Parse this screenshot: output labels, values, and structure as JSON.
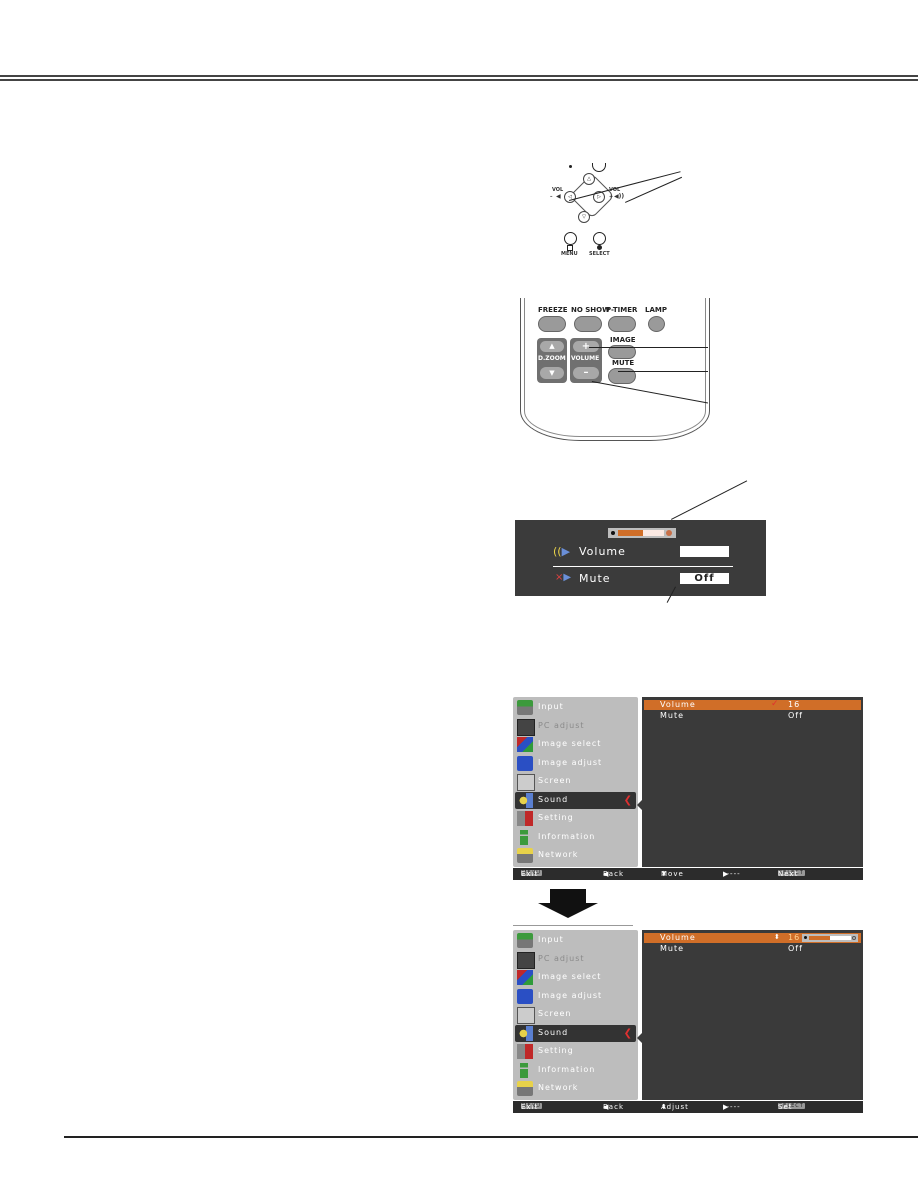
{
  "control_panel": {
    "vol_minus_label": "VOL",
    "vol_minus_sign": "–",
    "vol_plus_label": "VOL",
    "vol_plus_sign": "+",
    "menu_label": "MENU",
    "select_label": "SELECT"
  },
  "remote": {
    "freeze": "FREEZE",
    "no_show": "NO SHOW",
    "p_timer": "P-TIMER",
    "lamp": "LAMP",
    "image": "IMAGE",
    "mute": "MUTE",
    "d_zoom": "D.ZOOM",
    "volume": "VOLUME",
    "plus": "+",
    "minus": "–",
    "up": "▲",
    "down": "▼"
  },
  "volume_osd": {
    "volume_label": "Volume",
    "volume_value": "",
    "volume_level_fraction": 0.55,
    "mute_label": "Mute",
    "mute_value": "Off"
  },
  "menu_screen_1": {
    "items": [
      {
        "label": "Input",
        "icon": "input-icon",
        "dim": false
      },
      {
        "label": "PC adjust",
        "icon": "pc-adjust-icon",
        "dim": true
      },
      {
        "label": "Image select",
        "icon": "image-select-icon",
        "dim": false
      },
      {
        "label": "Image adjust",
        "icon": "image-adjust-icon",
        "dim": false
      },
      {
        "label": "Screen",
        "icon": "screen-icon",
        "dim": false
      },
      {
        "label": "Sound",
        "icon": "sound-icon",
        "dim": false,
        "selected": true
      },
      {
        "label": "Setting",
        "icon": "setting-icon",
        "dim": false
      },
      {
        "label": "Information",
        "icon": "information-icon",
        "dim": false
      },
      {
        "label": "Network",
        "icon": "network-icon",
        "dim": false
      }
    ],
    "submenu": [
      {
        "label": "Volume",
        "value": "16",
        "highlighted": true
      },
      {
        "label": "Mute",
        "value": "Off",
        "highlighted": false
      }
    ],
    "status": {
      "exit": "Exit",
      "exit_key": "MENU",
      "back": "Back",
      "move": "Move",
      "next_dashes": "-----",
      "next": "Next",
      "next_key": "SELECT"
    }
  },
  "menu_screen_2": {
    "submenu": [
      {
        "label": "Volume",
        "value": "16",
        "highlighted": true,
        "level_fraction": 0.5
      },
      {
        "label": "Mute",
        "value": "Off",
        "highlighted": false
      }
    ],
    "status": {
      "exit": "Exit",
      "exit_key": "MENU",
      "back": "Back",
      "adjust": "Adjust",
      "next_dashes": "-----",
      "set": "Set",
      "set_key": "SELECT"
    }
  },
  "colors": {
    "highlight": "#d06e28",
    "menu_dark": "#3a3a3a",
    "menu_light": "#bdbdbd",
    "accent_red": "#e03030"
  }
}
